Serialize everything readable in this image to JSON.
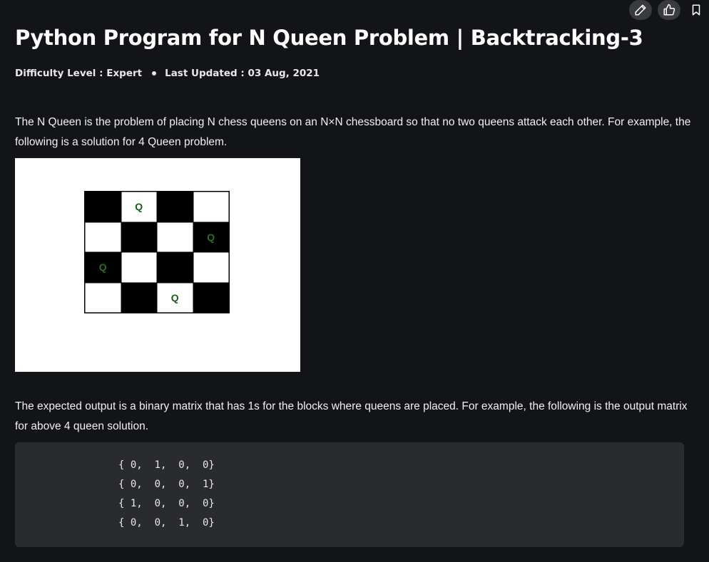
{
  "article": {
    "title": "Python Program for N Queen Problem | Backtracking-3",
    "difficulty": "Difficulty Level : Expert",
    "last_updated": "Last Updated : 03 Aug, 2021",
    "para1": "The N Queen is the problem of placing N chess queens on an N×N chessboard so that no two queens attack each other. For example, the following is a solution for 4 Queen problem.",
    "para2": "The expected output is a binary matrix that has 1s for the blocks where queens are placed. For example, the following is the output matrix for above 4 queen solution."
  },
  "toolbar": {
    "edit_icon": "pencil-icon",
    "like_icon": "thumbs-up-icon",
    "bookmark_icon": "bookmark-icon"
  },
  "board": {
    "queen_label": "Q",
    "cells": [
      [
        "black",
        "white",
        "black",
        "white"
      ],
      [
        "white",
        "black",
        "white",
        "black"
      ],
      [
        "black",
        "white",
        "black",
        "white"
      ],
      [
        "white",
        "black",
        "white",
        "black"
      ]
    ],
    "queens": [
      [
        0,
        1
      ],
      [
        1,
        3
      ],
      [
        2,
        0
      ],
      [
        3,
        2
      ]
    ]
  },
  "code": {
    "lines": [
      "{ 0,  1,  0,  0}",
      "{ 0,  0,  0,  1}",
      "{ 1,  0,  0,  0}",
      "{ 0,  0,  1,  0}"
    ]
  },
  "colors": {
    "background": "#131417",
    "code_background": "#2a2b2f",
    "queen_green": "#1e5a19"
  }
}
